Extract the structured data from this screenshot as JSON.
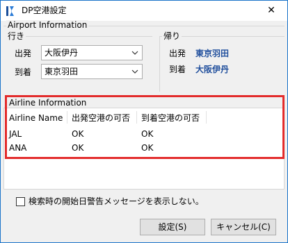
{
  "window": {
    "title": "DP空港設定",
    "close_glyph": "✕"
  },
  "airport_info": {
    "group_label": "Airport Information",
    "outbound": {
      "label": "行き",
      "departure_label": "出発",
      "departure_value": "大阪伊丹",
      "arrival_label": "到着",
      "arrival_value": "東京羽田"
    },
    "return": {
      "label": "帰り",
      "departure_label": "出発",
      "departure_value": "東京羽田",
      "arrival_label": "到着",
      "arrival_value": "大阪伊丹"
    }
  },
  "airline_info": {
    "group_label": "Airline Information",
    "columns": [
      "Airline Name",
      "出発空港の可否",
      "到着空港の可否"
    ],
    "rows": [
      [
        "JAL",
        "OK",
        "OK"
      ],
      [
        "ANA",
        "OK",
        "OK"
      ]
    ]
  },
  "checkbox": {
    "label": "検索時の開始日警告メッセージを表示しない。",
    "checked": false
  },
  "buttons": {
    "ok_label": "設定(S)",
    "cancel_label": "キャンセル(C)"
  },
  "colors": {
    "highlight_frame": "#e32b2b",
    "return_value_text": "#1f4e9c",
    "window_border": "#1a73c9"
  },
  "icons": {
    "app": "app-icon",
    "close": "close-icon",
    "chevron": "chevron-down-icon",
    "checkbox": "checkbox-icon"
  }
}
